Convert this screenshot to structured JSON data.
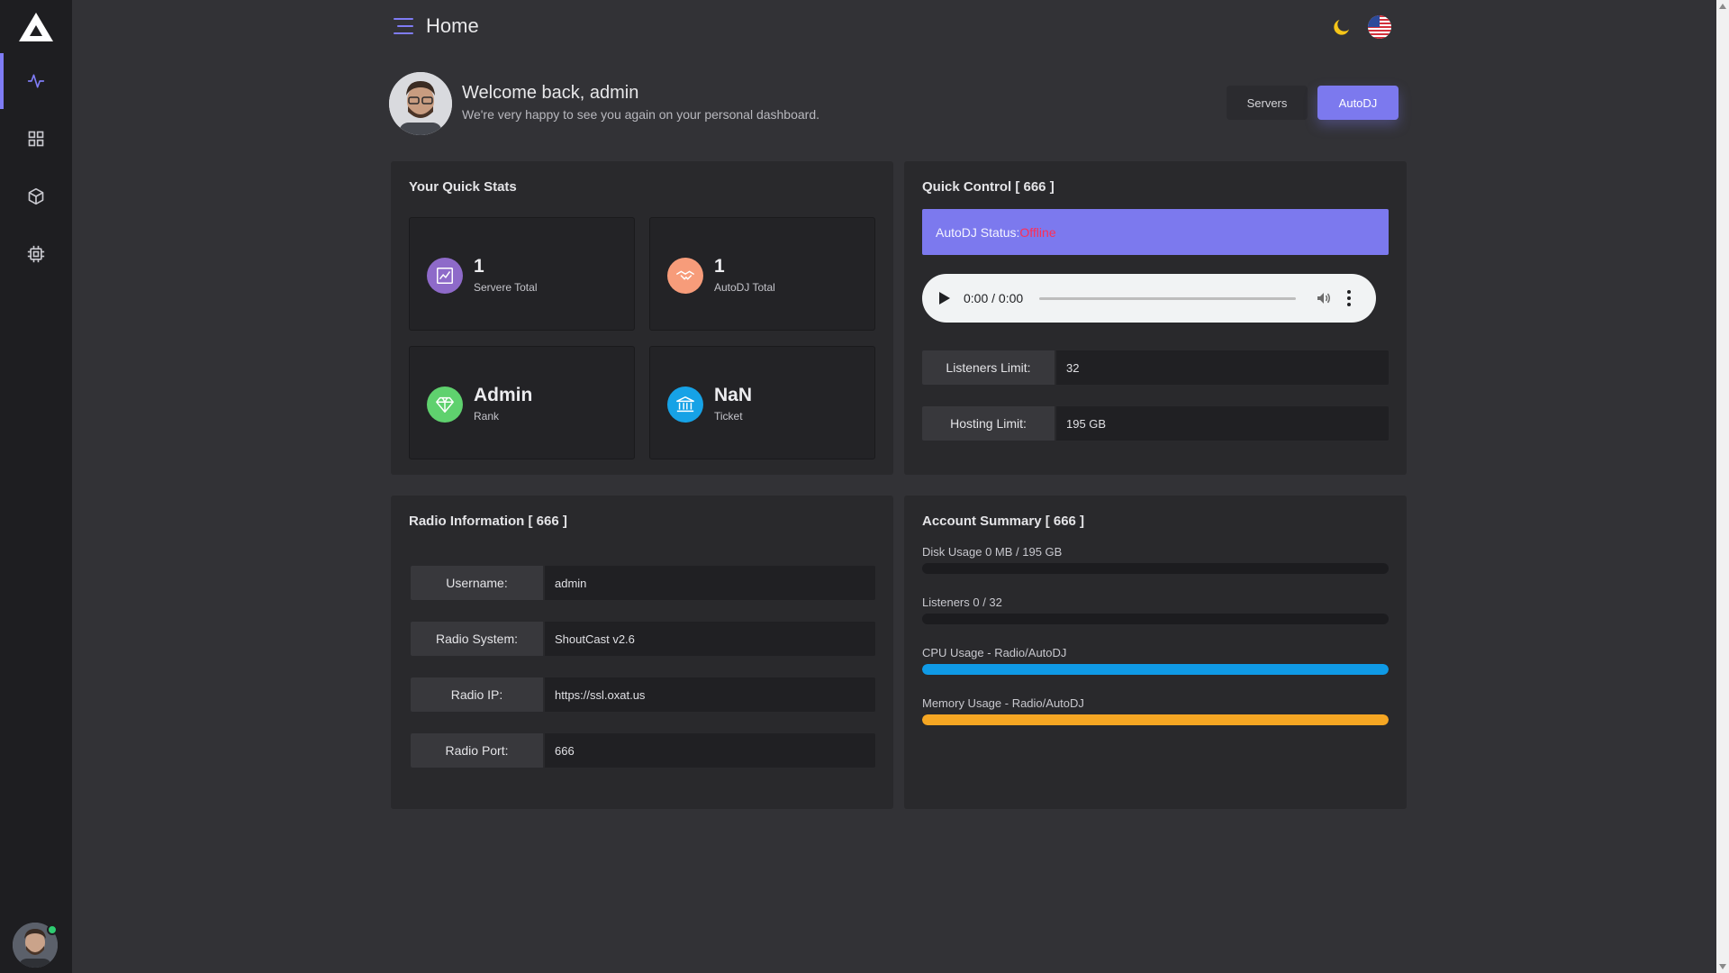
{
  "header": {
    "title": "Home"
  },
  "sidebar": {
    "items": [
      {
        "icon": "activity-icon",
        "active": true
      },
      {
        "icon": "grid-icon",
        "active": false
      },
      {
        "icon": "cube-icon",
        "active": false
      },
      {
        "icon": "cpu-icon",
        "active": false
      }
    ]
  },
  "welcome": {
    "title": "Welcome back, admin",
    "subtitle": "We're very happy to see you again on your personal dashboard."
  },
  "actions": {
    "servers_label": "Servers",
    "autodj_label": "AutoDJ"
  },
  "quick_stats": {
    "title": "Your Quick Stats",
    "cards": [
      {
        "value": "1",
        "label": "Servere Total",
        "icon": "chart-icon",
        "color": "#8e6ac9"
      },
      {
        "value": "1",
        "label": "AutoDJ Total",
        "icon": "handshake-icon",
        "color": "#f79c7a"
      },
      {
        "value": "Admin",
        "label": "Rank",
        "icon": "diamond-icon",
        "color": "#5fd16e"
      },
      {
        "value": "NaN",
        "label": "Ticket",
        "icon": "bank-icon",
        "color": "#16a2e6"
      }
    ]
  },
  "quick_control": {
    "title": "Quick Control [ 666 ]",
    "status_label": "AutoDJ Status:",
    "status_value": "Offline",
    "player_time": "0:00 / 0:00",
    "fields": [
      {
        "label": "Listeners Limit:",
        "value": "32"
      },
      {
        "label": "Hosting Limit:",
        "value": "195 GB"
      }
    ]
  },
  "radio_info": {
    "title": "Radio Information [ 666 ]",
    "fields": [
      {
        "label": "Username:",
        "value": "admin"
      },
      {
        "label": "Radio System:",
        "value": "ShoutCast v2.6"
      },
      {
        "label": "Radio IP:",
        "value": "https://ssl.oxat.us"
      },
      {
        "label": "Radio Port:",
        "value": "666"
      }
    ]
  },
  "account_summary": {
    "title": "Account Summary [ 666 ]",
    "usages": [
      {
        "label": "Disk Usage 0 MB / 195 GB",
        "percent": 0,
        "color": "#1c1c1f"
      },
      {
        "label": "Listeners 0 / 32",
        "percent": 0,
        "color": "#1c1c1f"
      },
      {
        "label": "CPU Usage - Radio/AutoDJ",
        "percent": 100,
        "color": "#0f9ae6"
      },
      {
        "label": "Memory Usage - Radio/AutoDJ",
        "percent": 100,
        "color": "#f5a623"
      }
    ]
  }
}
